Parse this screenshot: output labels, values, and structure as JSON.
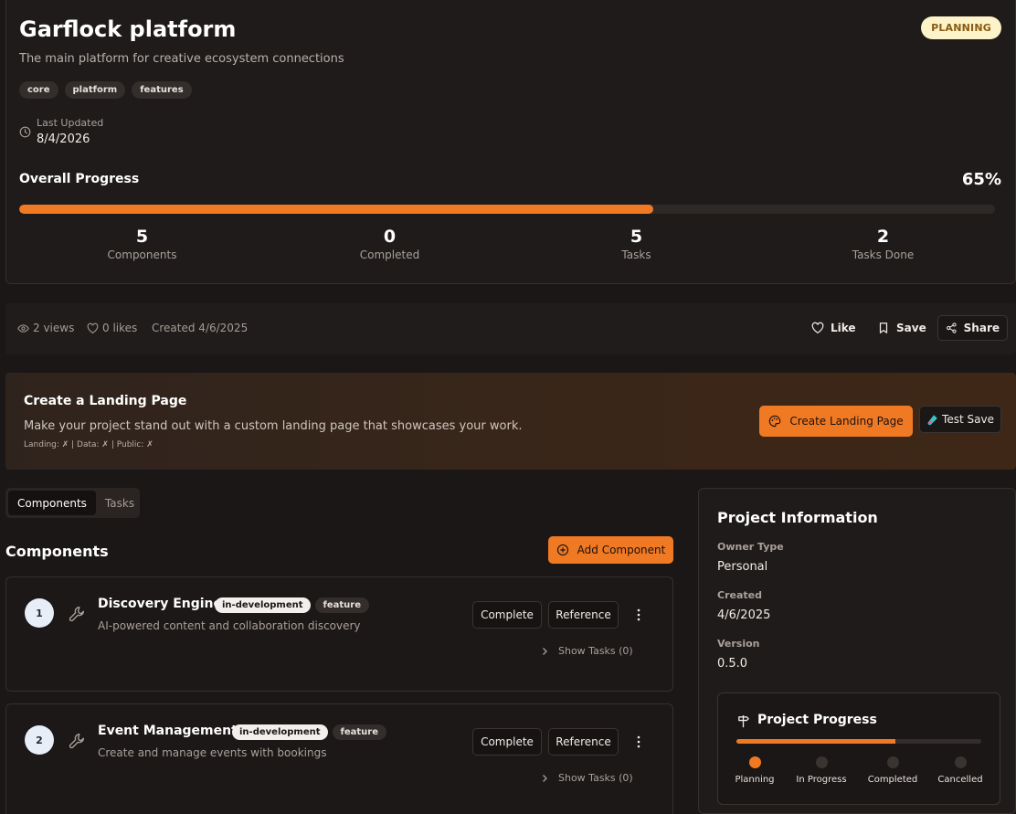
{
  "project": {
    "title": "Garflock platform",
    "description": "The main platform for creative ecosystem connections",
    "status": "PLANNING",
    "tags": [
      "core",
      "platform",
      "features"
    ],
    "last_updated_label": "Last Updated",
    "last_updated_value": "8/4/2026",
    "overall_progress_label": "Overall Progress",
    "overall_progress_value": "65%",
    "overall_progress_fraction": 0.65
  },
  "stats": [
    {
      "value": "5",
      "label": "Components"
    },
    {
      "value": "0",
      "label": "Completed"
    },
    {
      "value": "5",
      "label": "Tasks"
    },
    {
      "value": "2",
      "label": "Tasks Done"
    }
  ],
  "meta": {
    "views": "2 views",
    "likes": "0 likes",
    "created": "Created 4/6/2025",
    "like_label": "Like",
    "save_label": "Save",
    "share_label": "Share"
  },
  "landing": {
    "title": "Create a Landing Page",
    "description": "Make your project stand out with a custom landing page that showcases your work.",
    "status_line": "Landing: ✗ | Data: ✗ | Public: ✗",
    "create_button": "Create Landing Page",
    "test_button": "Test Save"
  },
  "tabs": [
    {
      "label": "Components",
      "active": true
    },
    {
      "label": "Tasks",
      "active": false
    }
  ],
  "components_section": {
    "heading": "Components",
    "add_button": "Add Component",
    "items": [
      {
        "number": "1",
        "name": "Discovery Engine",
        "status_badge": "in-development",
        "type_badge": "feature",
        "description": "AI-powered content and collaboration discovery",
        "complete_label": "Complete",
        "reference_label": "Reference",
        "show_tasks": "Show Tasks (0)"
      },
      {
        "number": "2",
        "name": "Event Management",
        "status_badge": "in-development",
        "type_badge": "feature",
        "description": "Create and manage events with bookings",
        "complete_label": "Complete",
        "reference_label": "Reference",
        "show_tasks": "Show Tasks (0)"
      }
    ]
  },
  "info": {
    "title": "Project Information",
    "owner_type_label": "Owner Type",
    "owner_type_value": "Personal",
    "created_label": "Created",
    "created_value": "4/6/2025",
    "version_label": "Version",
    "version_value": "0.5.0"
  },
  "project_progress": {
    "title": "Project Progress",
    "fraction": 0.65,
    "stages": [
      {
        "label": "Planning",
        "active": true
      },
      {
        "label": "In Progress",
        "active": false
      },
      {
        "label": "Completed",
        "active": false
      },
      {
        "label": "Cancelled",
        "active": false
      }
    ]
  },
  "colors": {
    "accent": "#f07a24",
    "status_badge_bg": "#fdf3c8",
    "background": "#1a1716"
  },
  "icons": [
    "clock-icon",
    "eye-icon",
    "heart-icon",
    "bookmark-icon",
    "share-icon",
    "palette-icon",
    "test-tube-icon",
    "plus-circle-icon",
    "wrench-icon",
    "chevron-right-icon",
    "kebab-icon",
    "signpost-icon"
  ]
}
